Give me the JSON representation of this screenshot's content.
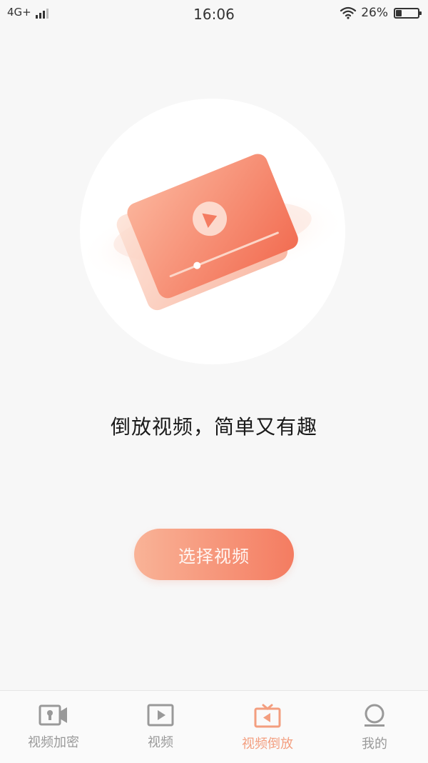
{
  "status_bar": {
    "network": "4G+",
    "time": "16:06",
    "battery": "26%",
    "battery_level": 0.26
  },
  "main": {
    "headline": "倒放视频，简单又有趣",
    "select_button_label": "选择视频"
  },
  "tab_bar": {
    "items": [
      {
        "label": "视频加密",
        "icon": "video-camera-lock-icon",
        "active": false
      },
      {
        "label": "视频",
        "icon": "play-square-icon",
        "active": false
      },
      {
        "label": "视频倒放",
        "icon": "tv-rewind-icon",
        "active": true
      },
      {
        "label": "我的",
        "icon": "user-icon",
        "active": false
      }
    ]
  },
  "colors": {
    "accent": "#f47c61",
    "accent_light": "#f9b397",
    "tab_active": "#f39e7f",
    "tab_inactive": "#999999",
    "background": "#f7f7f7"
  }
}
